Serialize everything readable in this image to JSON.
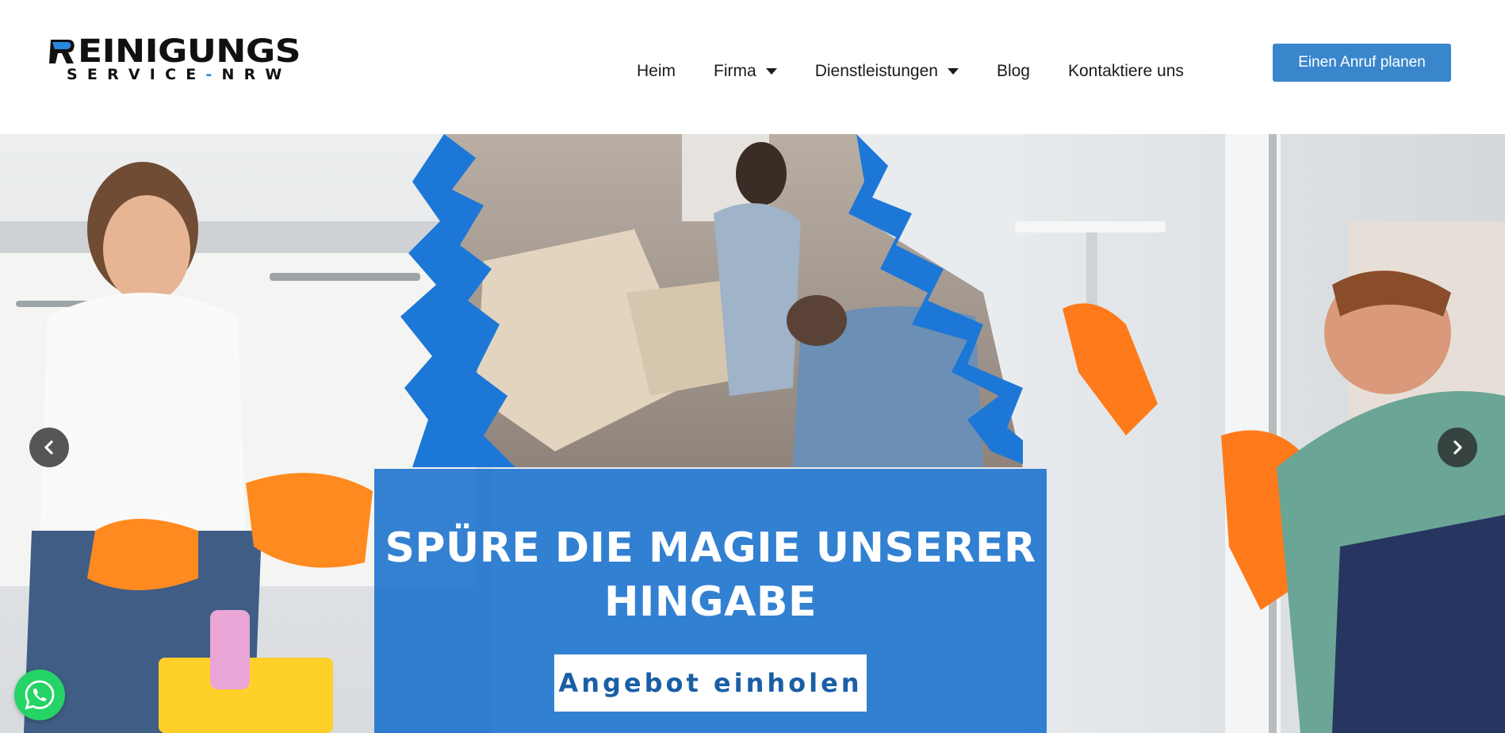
{
  "brand": {
    "logo_top": "EINIGUNGS",
    "logo_bottom_left": "SERVICE",
    "logo_bottom_dash": "-",
    "logo_bottom_right": "NRW",
    "logo_icon": "r-letter-icon",
    "accent_color": "#2a88dd"
  },
  "nav": {
    "items": [
      {
        "label": "Heim",
        "has_dropdown": false
      },
      {
        "label": "Firma",
        "has_dropdown": true
      },
      {
        "label": "Dienstleistungen",
        "has_dropdown": true
      },
      {
        "label": "Blog",
        "has_dropdown": false
      },
      {
        "label": "Kontaktiere uns",
        "has_dropdown": false
      }
    ]
  },
  "header": {
    "cta_label": "Einen Anruf planen",
    "cta_color": "#3a86cc"
  },
  "hero": {
    "title": "SPÜRE DIE MAGIE UNSERER HINGABE",
    "button_label": "Angebot einholen",
    "panel_color": "#146ecd",
    "prev_icon": "chevron-left-icon",
    "next_icon": "chevron-right-icon"
  },
  "floating": {
    "whatsapp_icon": "whatsapp-icon",
    "whatsapp_color": "#25d366"
  }
}
